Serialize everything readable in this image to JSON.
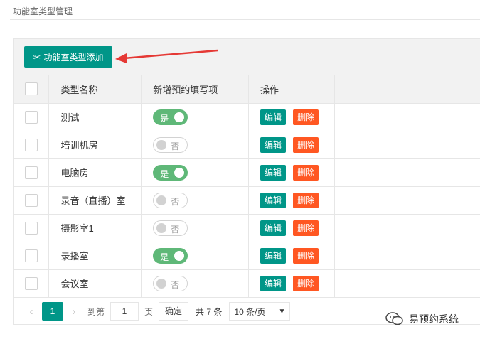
{
  "breadcrumb": "功能室类型管理",
  "toolbar": {
    "add_label": "功能室类型添加"
  },
  "table": {
    "headers": {
      "name": "类型名称",
      "toggle": "新增预约填写项",
      "ops": "操作"
    },
    "rows": [
      {
        "name": "测试",
        "toggle_on": true,
        "toggle_text": "是"
      },
      {
        "name": "培训机房",
        "toggle_on": false,
        "toggle_text": "否"
      },
      {
        "name": "电脑房",
        "toggle_on": true,
        "toggle_text": "是"
      },
      {
        "name": "录音（直播）室",
        "toggle_on": false,
        "toggle_text": "否"
      },
      {
        "name": "摄影室1",
        "toggle_on": false,
        "toggle_text": "否"
      },
      {
        "name": "录播室",
        "toggle_on": true,
        "toggle_text": "是"
      },
      {
        "name": "会议室",
        "toggle_on": false,
        "toggle_text": "否"
      }
    ],
    "edit_label": "编辑",
    "delete_label": "删除"
  },
  "pagination": {
    "prev_icon": "chevron-left-icon",
    "current_page": "1",
    "next_icon": "chevron-right-icon",
    "goto_label": "到第",
    "page_input": "1",
    "page_unit": "页",
    "confirm_label": "确定",
    "total_label": "共 7 条",
    "page_size": "10 条/页"
  },
  "watermark": {
    "text": "易预约系统",
    "icon": "wechat-icon"
  },
  "colors": {
    "primary": "#009688",
    "danger": "#ff5722",
    "switch_on": "#5fb878",
    "arrow": "#e53935"
  }
}
